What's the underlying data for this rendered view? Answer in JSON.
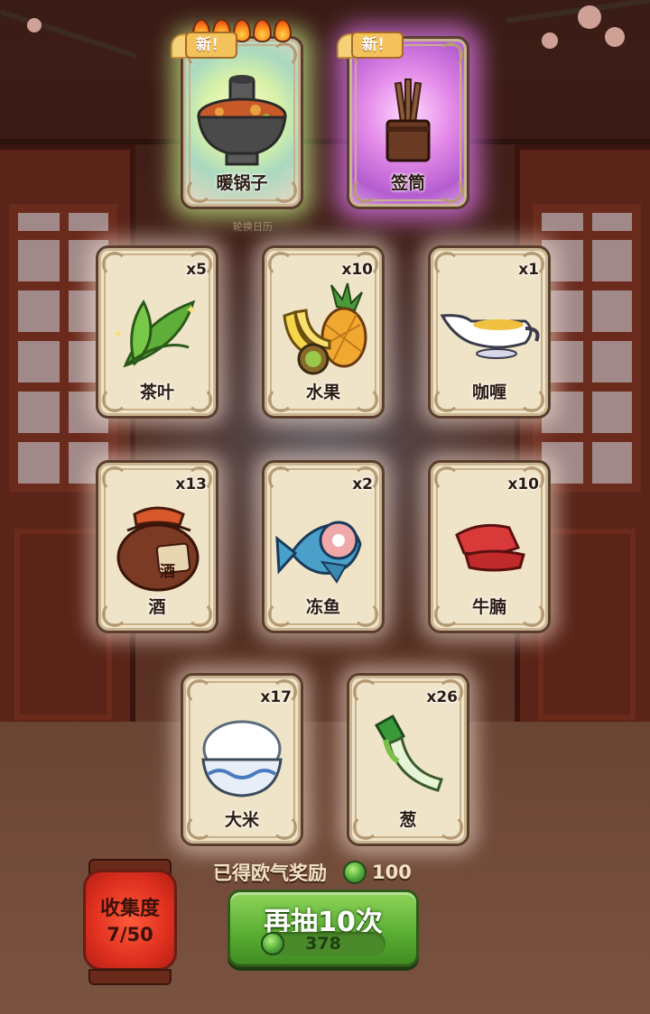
{
  "subtitle": "轮换日历",
  "featured_cards": [
    {
      "name": "暖锅子",
      "badge": "新！",
      "rarity": "green",
      "flames": 5,
      "icon": "hot-pot-icon"
    },
    {
      "name": "签筒",
      "badge": "新！",
      "rarity": "purple",
      "icon": "fortune-stick-holder-icon"
    }
  ],
  "cards": [
    {
      "name": "茶叶",
      "count": "x5",
      "icon": "tea-leaf-icon"
    },
    {
      "name": "水果",
      "count": "x10",
      "icon": "fruit-icon"
    },
    {
      "name": "咖喱",
      "count": "x1",
      "icon": "curry-sauce-icon"
    },
    {
      "name": "酒",
      "count": "x13",
      "icon": "wine-jar-icon"
    },
    {
      "name": "冻鱼",
      "count": "x2",
      "icon": "frozen-fish-icon"
    },
    {
      "name": "牛腩",
      "count": "x10",
      "icon": "beef-brisket-icon"
    },
    {
      "name": "大米",
      "count": "x17",
      "icon": "rice-bowl-icon"
    },
    {
      "name": "葱",
      "count": "x26",
      "icon": "scallion-icon"
    }
  ],
  "reward": {
    "label": "已得欧气奖励",
    "value": "100",
    "icon": "green-coin-icon"
  },
  "collection": {
    "label": "收集度",
    "value": "7/50"
  },
  "draw_button": {
    "label": "再抽10次",
    "cost": "378",
    "icon": "green-coin-icon"
  },
  "wine_jar_label": "酒",
  "colors": {
    "green_button": "#5cb034",
    "card_bg": "#f0e4c8",
    "lantern": "#e0301f",
    "rare_purple": "#e38ae8",
    "rare_green": "#d8f2a8"
  }
}
